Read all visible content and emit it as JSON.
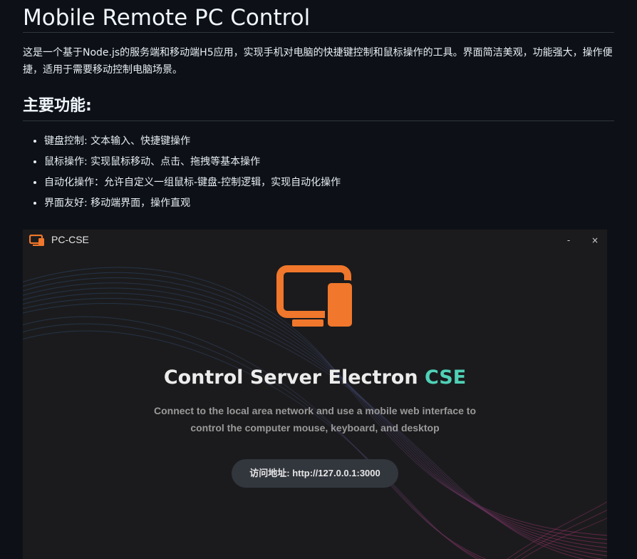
{
  "readme": {
    "title": "Mobile Remote PC Control",
    "description": "这是一个基于Node.js的服务端和移动端H5应用，实现手机对电脑的快捷键控制和鼠标操作的工具。界面简洁美观，功能强大，操作便捷，适用于需要移动控制电脑场景。",
    "features_heading": "主要功能:",
    "features": [
      "键盘控制: 文本输入、快捷键操作",
      "鼠标操作: 实现鼠标移动、点击、拖拽等基本操作",
      "自动化操作：允许自定义一组鼠标-键盘-控制逻辑，实现自动化操作",
      "界面友好: 移动端界面，操作直观"
    ]
  },
  "app": {
    "window_title": "PC-CSE",
    "minimize_glyph": "-",
    "close_glyph": "×",
    "app_icon": "monitor-phone-icon",
    "headline_main": "Control Server Electron",
    "headline_accent": "CSE",
    "subtitle_line1": "Connect to the local area network and use a mobile web interface to",
    "subtitle_line2": "control the computer mouse, keyboard, and desktop",
    "address": "访问地址: http://127.0.0.1:3000"
  },
  "colors": {
    "page_bg": "#0d1117",
    "app_bg": "#1b1b1d",
    "brand_orange": "#f0772b",
    "accent_teal": "#4fd1b6",
    "pill_bg": "#32363d"
  }
}
